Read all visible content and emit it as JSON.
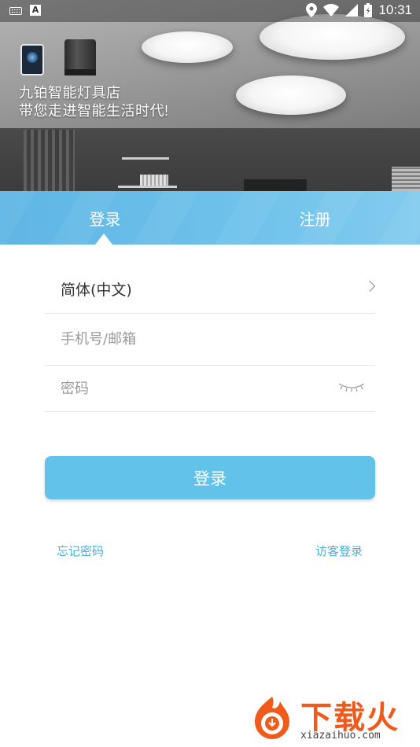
{
  "status_bar": {
    "time": "10:31",
    "left_icons": [
      "keyboard-icon",
      "a-icon"
    ],
    "right_icons": [
      "location-icon",
      "wifi-icon",
      "signal-icon",
      "battery-icon"
    ]
  },
  "hero": {
    "line1": "九铂智能灯具店",
    "line2": "带您走进智能生活时代!"
  },
  "tabs": {
    "login": "登录",
    "register": "注册",
    "active": "login"
  },
  "form": {
    "language": "简体(中文)",
    "phone_placeholder": "手机号/邮箱",
    "password_placeholder": "密码"
  },
  "login_button": "登录",
  "links": {
    "forgot_password": "忘记密码",
    "guest_login": "访客登录"
  },
  "watermark": {
    "brand": "下载火",
    "url": "xiazaihuo.com"
  },
  "colors": {
    "accent": "#63c2ea",
    "link": "#4aaee0",
    "watermark": "#f05a1a"
  }
}
